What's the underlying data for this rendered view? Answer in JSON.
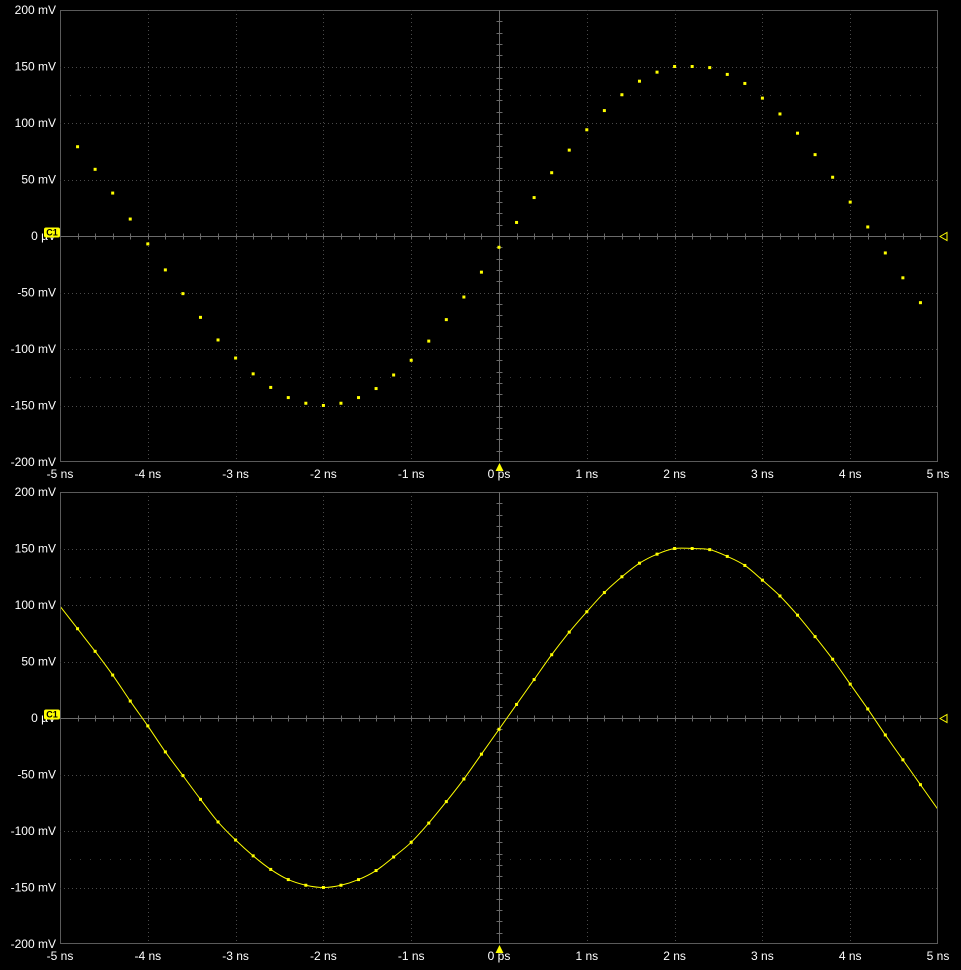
{
  "colors": {
    "background": "#000000",
    "frame": "#5a5a5a",
    "grid": "#4a4a4a",
    "label": "#ffffff",
    "trace": "#ffff00"
  },
  "channel_label": "C1",
  "chart_data": [
    {
      "type": "scatter",
      "title": "",
      "xlabel": "",
      "ylabel": "",
      "xlim": [
        -5,
        5
      ],
      "ylim": [
        -200,
        200
      ],
      "x_unit": "ns",
      "y_unit": "mV",
      "x_tick_values": [
        -5,
        -4,
        -3,
        -2,
        -1,
        0,
        1,
        2,
        3,
        4,
        5
      ],
      "x_tick_labels": [
        "-5 ns",
        "-4 ns",
        "-3 ns",
        "-2 ns",
        "-1 ns",
        "0 ps",
        "1 ns",
        "2 ns",
        "3 ns",
        "4 ns",
        "5 ns"
      ],
      "y_tick_values": [
        200,
        150,
        100,
        50,
        0,
        -50,
        -100,
        -150,
        -200
      ],
      "y_tick_labels": [
        "200 mV",
        "150 mV",
        "100 mV",
        "50 mV",
        "0 µV",
        "-50 mV",
        "-100 mV",
        "-150 mV",
        "-200 mV"
      ],
      "grid": true,
      "interpolated_line": false,
      "series": [
        {
          "x": [
            -4.8,
            -4.6,
            -4.4,
            -4.2,
            -4.0,
            -3.8,
            -3.6,
            -3.4,
            -3.2,
            -3.0,
            -2.8,
            -2.6,
            -2.4,
            -2.2,
            -2.0,
            -1.8,
            -1.6,
            -1.4,
            -1.2,
            -1.0,
            -0.8,
            -0.6,
            -0.4,
            -0.2,
            0.0,
            0.2,
            0.4,
            0.6,
            0.8,
            1.0,
            1.2,
            1.4,
            1.6,
            1.8,
            2.0,
            2.2,
            2.4,
            2.6,
            2.8,
            3.0,
            3.2,
            3.4,
            3.6,
            3.8,
            4.0,
            4.2,
            4.4,
            4.6,
            4.8
          ],
          "y": [
            79,
            59,
            38,
            15,
            -7,
            -30,
            -51,
            -72,
            -92,
            -108,
            -122,
            -134,
            -143,
            -148,
            -150,
            -148,
            -143,
            -135,
            -123,
            -110,
            -93,
            -74,
            -54,
            -32,
            -10,
            12,
            34,
            56,
            76,
            94,
            111,
            125,
            137,
            145,
            150,
            150,
            149,
            143,
            135,
            122,
            108,
            91,
            72,
            52,
            30,
            8,
            -15,
            -37,
            -59
          ]
        }
      ]
    },
    {
      "type": "line",
      "title": "",
      "xlabel": "",
      "ylabel": "",
      "xlim": [
        -5,
        5
      ],
      "ylim": [
        -200,
        200
      ],
      "x_unit": "ns",
      "y_unit": "mV",
      "x_tick_values": [
        -5,
        -4,
        -3,
        -2,
        -1,
        0,
        1,
        2,
        3,
        4,
        5
      ],
      "x_tick_labels": [
        "-5 ns",
        "-4 ns",
        "-3 ns",
        "-2 ns",
        "-1 ns",
        "0 ps",
        "1 ns",
        "2 ns",
        "3 ns",
        "4 ns",
        "5 ns"
      ],
      "y_tick_values": [
        200,
        150,
        100,
        50,
        0,
        -50,
        -100,
        -150,
        -200
      ],
      "y_tick_labels": [
        "200 mV",
        "150 mV",
        "100 mV",
        "50 mV",
        "0 µV",
        "-50 mV",
        "-100 mV",
        "-150 mV",
        "-200 mV"
      ],
      "grid": true,
      "interpolated_line": true,
      "series": [
        {
          "x": [
            -4.8,
            -4.6,
            -4.4,
            -4.2,
            -4.0,
            -3.8,
            -3.6,
            -3.4,
            -3.2,
            -3.0,
            -2.8,
            -2.6,
            -2.4,
            -2.2,
            -2.0,
            -1.8,
            -1.6,
            -1.4,
            -1.2,
            -1.0,
            -0.8,
            -0.6,
            -0.4,
            -0.2,
            0.0,
            0.2,
            0.4,
            0.6,
            0.8,
            1.0,
            1.2,
            1.4,
            1.6,
            1.8,
            2.0,
            2.2,
            2.4,
            2.6,
            2.8,
            3.0,
            3.2,
            3.4,
            3.6,
            3.8,
            4.0,
            4.2,
            4.4,
            4.6,
            4.8
          ],
          "y": [
            79,
            59,
            38,
            15,
            -7,
            -30,
            -51,
            -72,
            -92,
            -108,
            -122,
            -134,
            -143,
            -148,
            -150,
            -148,
            -143,
            -135,
            -123,
            -110,
            -93,
            -74,
            -54,
            -32,
            -10,
            12,
            34,
            56,
            76,
            94,
            111,
            125,
            137,
            145,
            150,
            150,
            149,
            143,
            135,
            122,
            108,
            91,
            72,
            52,
            30,
            8,
            -15,
            -37,
            -59
          ]
        }
      ]
    }
  ]
}
